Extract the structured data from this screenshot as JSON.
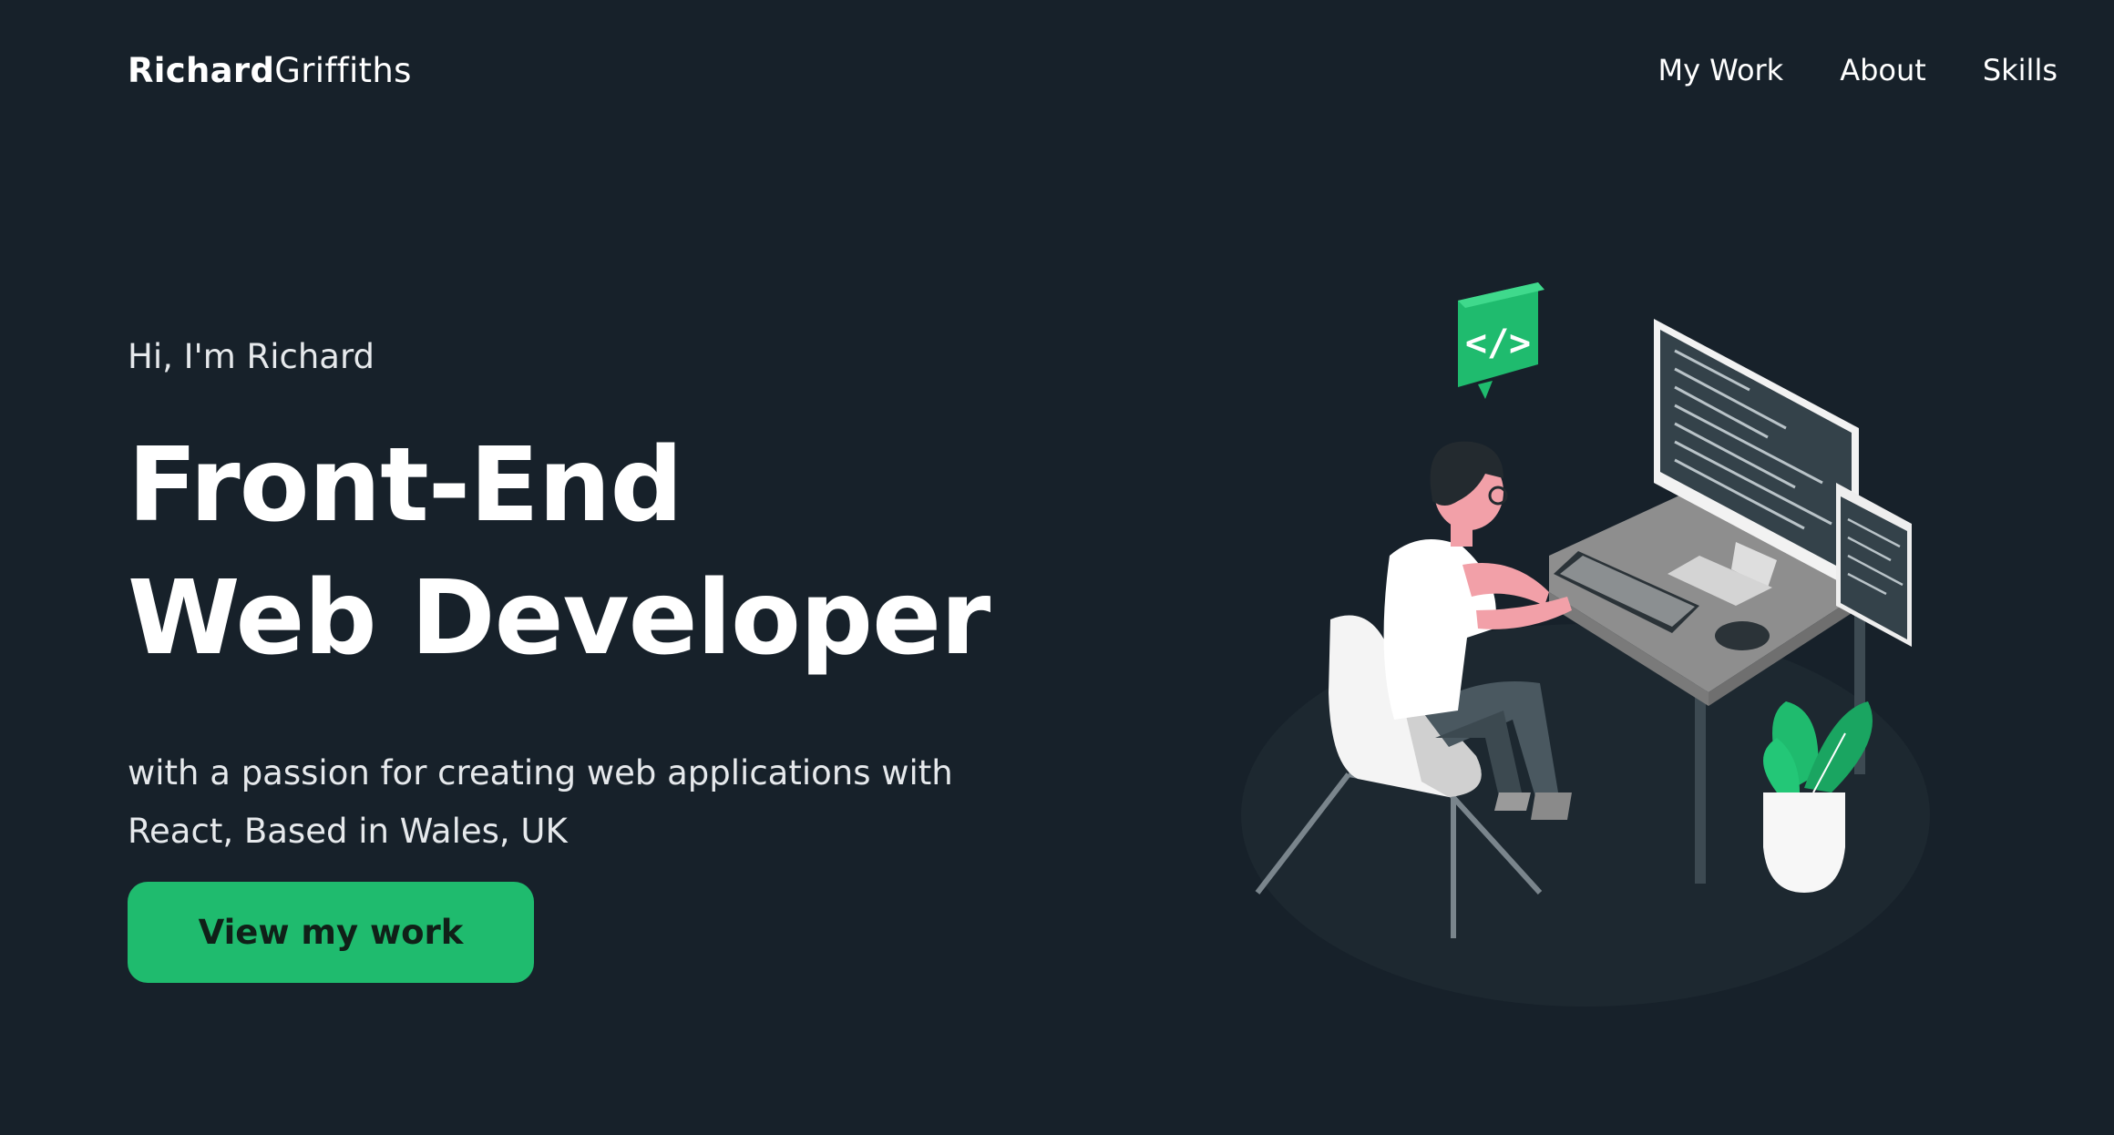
{
  "header": {
    "logo_first": "Richard",
    "logo_last": "Griffiths",
    "nav": [
      "My Work",
      "About",
      "Skills"
    ]
  },
  "hero": {
    "greeting": "Hi, I'm Richard",
    "headline_line1": "Front-End",
    "headline_line2": "Web Developer",
    "tagline": "with a passion for creating web applications with React, Based in Wales, UK",
    "cta_label": "View my work",
    "badge_code": "</>"
  },
  "colors": {
    "background": "#17212a",
    "accent": "#1fbb6e",
    "text": "#ffffff"
  },
  "icons": {
    "code_badge": "code-bubble-icon"
  }
}
